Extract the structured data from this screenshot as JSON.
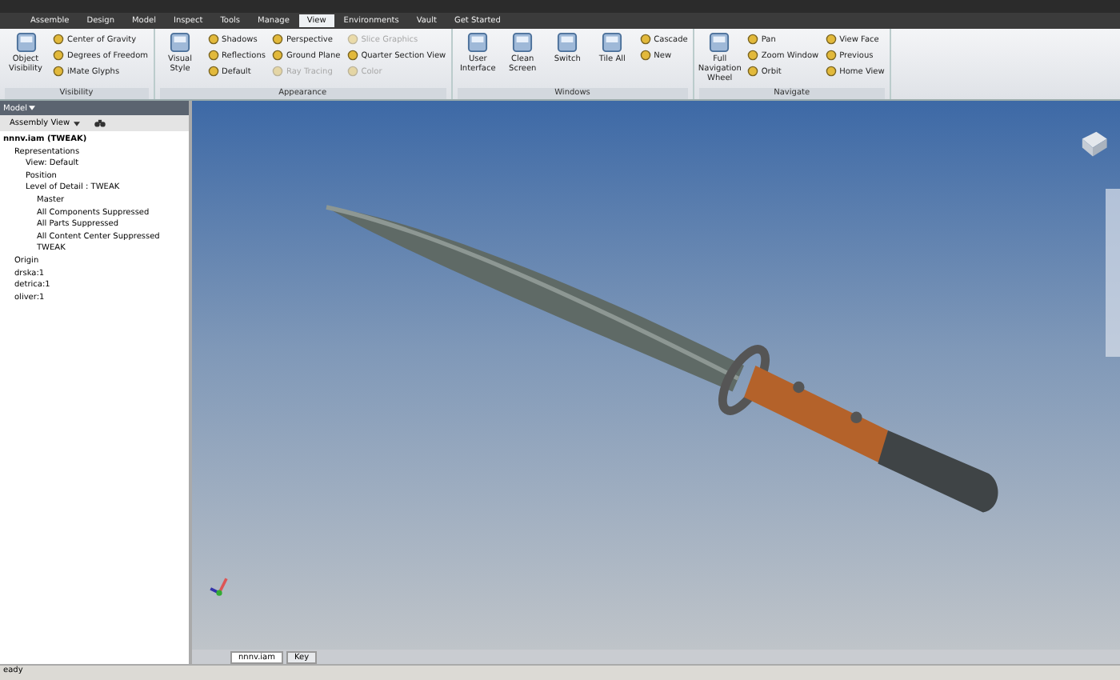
{
  "tabs": [
    {
      "label": "Assemble",
      "selected": false
    },
    {
      "label": "Design",
      "selected": false
    },
    {
      "label": "Model",
      "selected": false
    },
    {
      "label": "Inspect",
      "selected": false
    },
    {
      "label": "Tools",
      "selected": false
    },
    {
      "label": "Manage",
      "selected": false
    },
    {
      "label": "View",
      "selected": true
    },
    {
      "label": "Environments",
      "selected": false
    },
    {
      "label": "Vault",
      "selected": false
    },
    {
      "label": "Get Started",
      "selected": false
    }
  ],
  "ribbon": [
    {
      "label": "Visibility",
      "columns": [
        {
          "kind": "large",
          "items": [
            {
              "label": "Object Visibility",
              "disabled": false
            }
          ]
        },
        {
          "kind": "small",
          "items": [
            {
              "label": "Center of Gravity",
              "disabled": false
            },
            {
              "label": "Degrees of Freedom",
              "disabled": false
            },
            {
              "label": "iMate Glyphs",
              "disabled": false
            }
          ]
        }
      ]
    },
    {
      "label": "Appearance",
      "columns": [
        {
          "kind": "large",
          "items": [
            {
              "label": "Visual Style",
              "disabled": false
            }
          ]
        },
        {
          "kind": "small",
          "items": [
            {
              "label": "Shadows",
              "disabled": false
            },
            {
              "label": "Reflections",
              "disabled": false
            },
            {
              "label": "Default",
              "disabled": false
            }
          ]
        },
        {
          "kind": "small",
          "items": [
            {
              "label": "Perspective",
              "disabled": false
            },
            {
              "label": "Ground Plane",
              "disabled": false
            },
            {
              "label": "Ray Tracing",
              "disabled": true
            }
          ]
        },
        {
          "kind": "small",
          "items": [
            {
              "label": "Slice Graphics",
              "disabled": true
            },
            {
              "label": "Quarter Section View",
              "disabled": false
            },
            {
              "label": "Color",
              "disabled": true
            }
          ]
        }
      ]
    },
    {
      "label": "Windows",
      "columns": [
        {
          "kind": "large",
          "items": [
            {
              "label": "User Interface",
              "disabled": false
            },
            {
              "label": "Clean Screen",
              "disabled": false
            },
            {
              "label": "Switch",
              "disabled": false
            },
            {
              "label": "Tile All",
              "disabled": false
            }
          ]
        },
        {
          "kind": "small",
          "items": [
            {
              "label": "Cascade",
              "disabled": false
            },
            {
              "label": "New",
              "disabled": false
            }
          ]
        }
      ]
    },
    {
      "label": "Navigate",
      "columns": [
        {
          "kind": "large",
          "items": [
            {
              "label": "Full Navigation Wheel",
              "disabled": false
            }
          ]
        },
        {
          "kind": "small",
          "items": [
            {
              "label": "Pan",
              "disabled": false
            },
            {
              "label": "Zoom Window",
              "disabled": false
            },
            {
              "label": "Orbit",
              "disabled": false
            }
          ]
        },
        {
          "kind": "small",
          "items": [
            {
              "label": "View Face",
              "disabled": false
            },
            {
              "label": "Previous",
              "disabled": false
            },
            {
              "label": "Home View",
              "disabled": false
            }
          ]
        }
      ]
    }
  ],
  "browser": {
    "title": "Model",
    "view": "Assembly View",
    "tree": [
      {
        "label": "nnnv.iam (TWEAK)",
        "children": [
          {
            "label": "Representations",
            "children": [
              {
                "label": "View: Default"
              },
              {
                "label": "Position"
              },
              {
                "label": "Level of Detail : TWEAK",
                "children": [
                  {
                    "label": "Master"
                  },
                  {
                    "label": "All Components Suppressed"
                  },
                  {
                    "label": "All Parts Suppressed"
                  },
                  {
                    "label": "All Content Center Suppressed"
                  },
                  {
                    "label": "TWEAK"
                  }
                ]
              }
            ]
          },
          {
            "label": "Origin"
          },
          {
            "label": "drska:1"
          },
          {
            "label": "detrica:1"
          },
          {
            "label": "oliver:1"
          }
        ]
      }
    ]
  },
  "doc_tabs": [
    {
      "label": "nnnv.iam",
      "selected": true
    },
    {
      "label": "Key",
      "selected": false
    }
  ],
  "status_bar": "eady"
}
